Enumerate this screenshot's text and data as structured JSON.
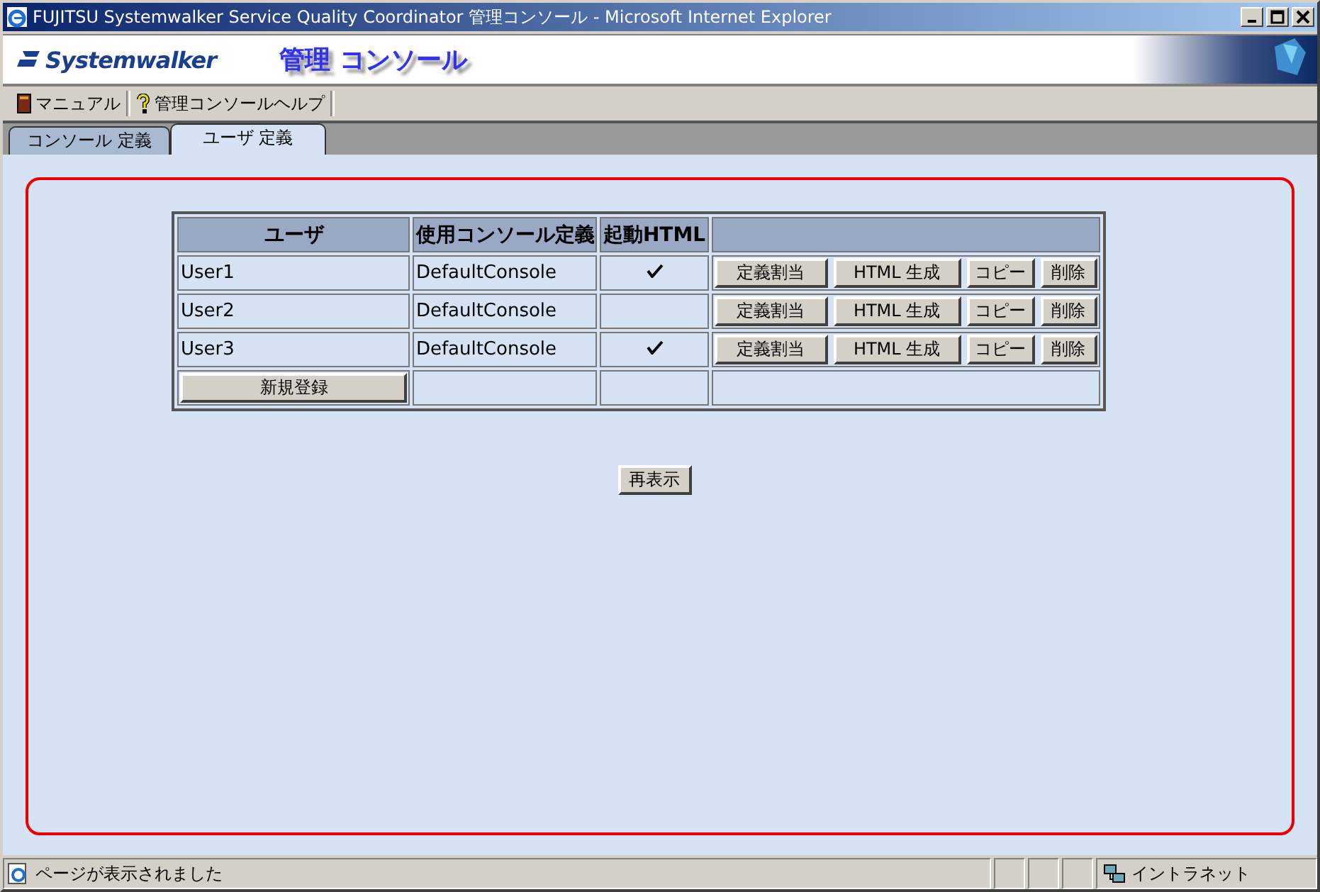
{
  "window": {
    "title": "FUJITSU Systemwalker Service Quality Coordinator 管理コンソール - Microsoft Internet Explorer"
  },
  "banner": {
    "logo": "Systemwalker",
    "heading": "管理 コンソール"
  },
  "toolbar": [
    {
      "label": "マニュアル",
      "kind": "book"
    },
    {
      "label": "管理コンソールヘルプ",
      "kind": "help"
    }
  ],
  "tabs": [
    {
      "label": "コンソール 定義",
      "selected": false
    },
    {
      "label": "ユーザ 定義",
      "selected": true
    }
  ],
  "table": {
    "columns": [
      "ユーザ",
      "使用コンソール定義",
      "起動HTML"
    ],
    "rows": [
      {
        "user": "User1",
        "console": "DefaultConsole",
        "launch_html": true,
        "actions": [
          "定義割当",
          "HTML 生成",
          "コピー",
          "削除"
        ]
      },
      {
        "user": "User2",
        "console": "DefaultConsole",
        "launch_html": false,
        "actions": [
          "定義割当",
          "HTML 生成",
          "コピー",
          "削除"
        ]
      },
      {
        "user": "User3",
        "console": "DefaultConsole",
        "launch_html": true,
        "actions": [
          "定義割当",
          "HTML 生成",
          "コピー",
          "削除"
        ]
      }
    ],
    "new_button": "新規登録"
  },
  "refresh_button": "再表示",
  "status_bar": {
    "text": "ページが表示されました",
    "zone": "イントラネット"
  }
}
